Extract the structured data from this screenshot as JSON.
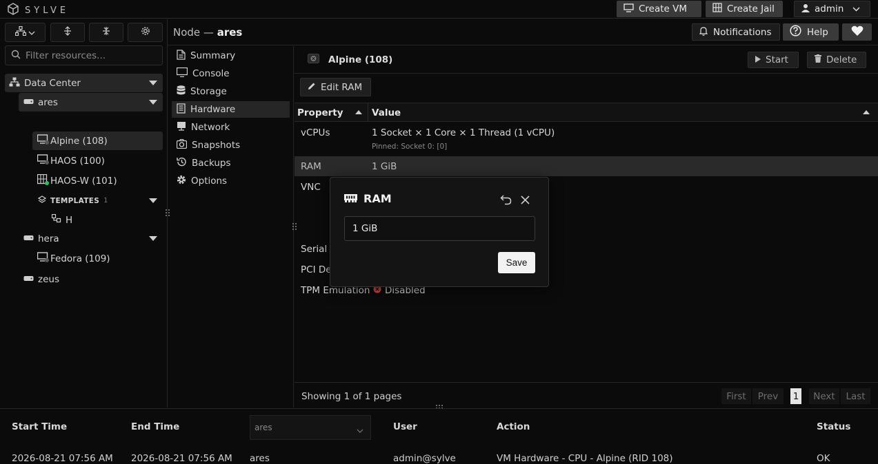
{
  "app": {
    "logo_text": "SYLVE"
  },
  "topbar": {
    "create_vm": "Create VM",
    "create_jail": "Create Jail",
    "user": "admin"
  },
  "node_header": {
    "prefix": "Node —",
    "name": "ares",
    "notifications": "Notifications",
    "help": "Help"
  },
  "sidebar": {
    "filter_placeholder": "Filter resources...",
    "tree": [
      {
        "label": "Data Center",
        "icon": "datacenter-icon"
      },
      {
        "label": "ares",
        "icon": "server-icon"
      },
      {
        "label": "Alpine (108)",
        "icon": "vm-monitor-icon",
        "status": "stopped"
      },
      {
        "label": "HAOS (100)",
        "icon": "vm-monitor-icon",
        "status": "stopped"
      },
      {
        "label": "HAOS-W (101)",
        "icon": "vm-container-icon",
        "status": "running"
      },
      {
        "label": "TEMPLATES",
        "count": "1",
        "icon": "layers-icon"
      },
      {
        "label": "H",
        "icon": "template-icon"
      },
      {
        "label": "hera",
        "icon": "server-icon"
      },
      {
        "label": "Fedora (109)",
        "icon": "vm-monitor-icon",
        "status": "stopped"
      },
      {
        "label": "zeus",
        "icon": "server-icon"
      }
    ]
  },
  "menu": {
    "items": [
      {
        "label": "Summary",
        "icon": "summary-icon"
      },
      {
        "label": "Console",
        "icon": "console-icon"
      },
      {
        "label": "Storage",
        "icon": "storage-icon"
      },
      {
        "label": "Hardware",
        "icon": "hardware-icon"
      },
      {
        "label": "Network",
        "icon": "network-icon"
      },
      {
        "label": "Snapshots",
        "icon": "snapshot-icon"
      },
      {
        "label": "Backups",
        "icon": "backup-icon"
      },
      {
        "label": "Options",
        "icon": "gear-icon"
      }
    ],
    "selected": "Hardware"
  },
  "vm": {
    "title": "Alpine (108)",
    "start": "Start",
    "delete": "Delete",
    "edit_ram": "Edit RAM"
  },
  "table": {
    "headers": {
      "property": "Property",
      "value": "Value"
    },
    "rows": [
      {
        "property": "vCPUs",
        "value": "1 Socket × 1 Core × 1 Thread (1 vCPU)",
        "sub": "Pinned: Socket 0: [0]"
      },
      {
        "property": "RAM",
        "value": "1 GiB"
      },
      {
        "property": "VNC",
        "value": ""
      },
      {
        "property": "Serial C",
        "value": ""
      },
      {
        "property": "PCI De",
        "value": ""
      },
      {
        "property": "TPM Emulation",
        "value": "Disabled"
      }
    ],
    "footer": "Showing 1 of 1 pages",
    "pager": {
      "first": "First",
      "prev": "Prev",
      "page": "1",
      "next": "Next",
      "last": "Last"
    }
  },
  "modal": {
    "title": "RAM",
    "value": "1 GiB",
    "save": "Save"
  },
  "log": {
    "headers": {
      "start": "Start Time",
      "end": "End Time",
      "node_filter": "ares",
      "user": "User",
      "action": "Action",
      "status": "Status"
    },
    "rows": [
      {
        "start": "2026-08-21 07:56 AM",
        "end": "2026-08-21 07:56 AM",
        "node": "ares",
        "user": "admin@sylve",
        "action": "VM Hardware - CPU - Alpine (RID 108)",
        "status": "OK"
      }
    ]
  },
  "colors": {
    "running": "#22c55e",
    "stopped": "#5a5a5a",
    "disabled": "#e04444",
    "selected_row": "#2a2a2a"
  }
}
